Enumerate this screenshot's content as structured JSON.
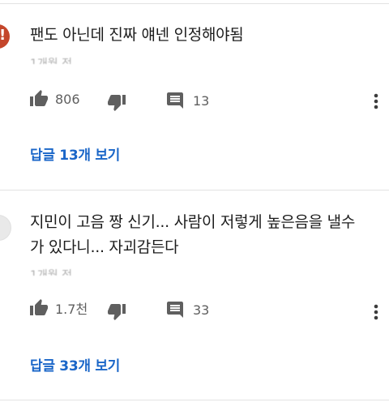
{
  "comments": [
    {
      "text": "팬도 아닌데 진짜 얘넨 인정해야됨",
      "meta": "1개월 전",
      "likes": "806",
      "reply_count": "13",
      "view_replies": "답글 13개 보기"
    },
    {
      "text": "지민이 고음 짱 신기... 사람이 저렇게 높은음을 낼수 가 있다니... 자괴감든다",
      "meta": "1개월 전",
      "likes": "1.7천",
      "reply_count": "33",
      "view_replies": "답글 33개 보기"
    }
  ],
  "icons": [
    "thumb-up-icon",
    "thumb-down-icon",
    "reply-icon",
    "more-vert-icon"
  ],
  "colors": {
    "link": "#1a66c8",
    "icon": "#5f5f5f",
    "divider": "#e3e3e3"
  }
}
